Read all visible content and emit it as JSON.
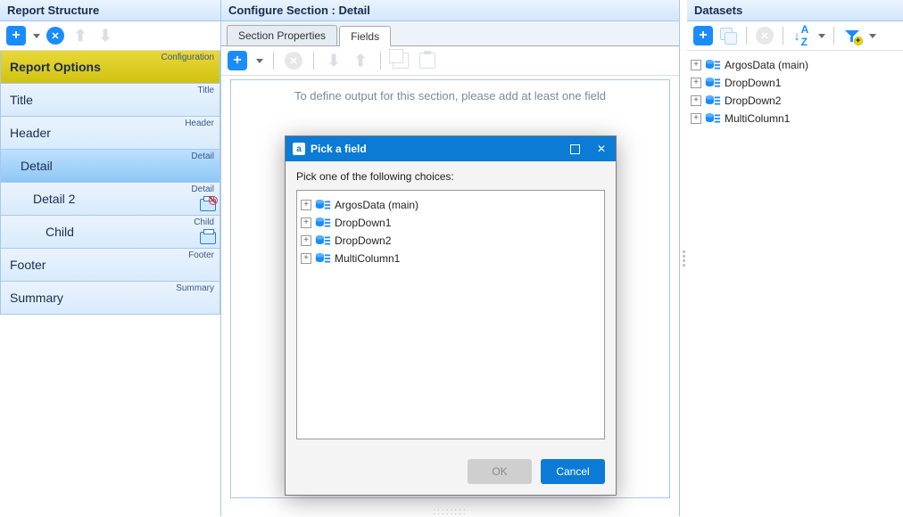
{
  "left": {
    "title": "Report Structure",
    "items": [
      {
        "label": "Report Options",
        "tag": "Configuration",
        "kind": "config",
        "indent": 0
      },
      {
        "label": "Title",
        "tag": "Title",
        "kind": "normal",
        "indent": 0
      },
      {
        "label": "Header",
        "tag": "Header",
        "kind": "normal",
        "indent": 0
      },
      {
        "label": "Detail",
        "tag": "Detail",
        "kind": "selected",
        "indent": 1
      },
      {
        "label": "Detail 2",
        "tag": "Detail",
        "kind": "printer-off",
        "indent": 2
      },
      {
        "label": "Child",
        "tag": "Child",
        "kind": "printer",
        "indent": 3
      },
      {
        "label": "Footer",
        "tag": "Footer",
        "kind": "normal",
        "indent": 0
      },
      {
        "label": "Summary",
        "tag": "Summary",
        "kind": "normal",
        "indent": 0
      }
    ]
  },
  "center": {
    "title": "Configure Section : Detail",
    "tabs": [
      {
        "label": "Section Properties",
        "active": false
      },
      {
        "label": "Fields",
        "active": true
      }
    ],
    "placeholder": "To define output for this section, please add at least one field"
  },
  "right": {
    "title": "Datasets",
    "items": [
      "ArgosData (main)",
      "DropDown1",
      "DropDown2",
      "MultiColumn1"
    ]
  },
  "dialog": {
    "title": "Pick a field",
    "message": "Pick one of the following choices:",
    "choices": [
      "ArgosData (main)",
      "DropDown1",
      "DropDown2",
      "MultiColumn1"
    ],
    "ok": "OK",
    "cancel": "Cancel"
  }
}
